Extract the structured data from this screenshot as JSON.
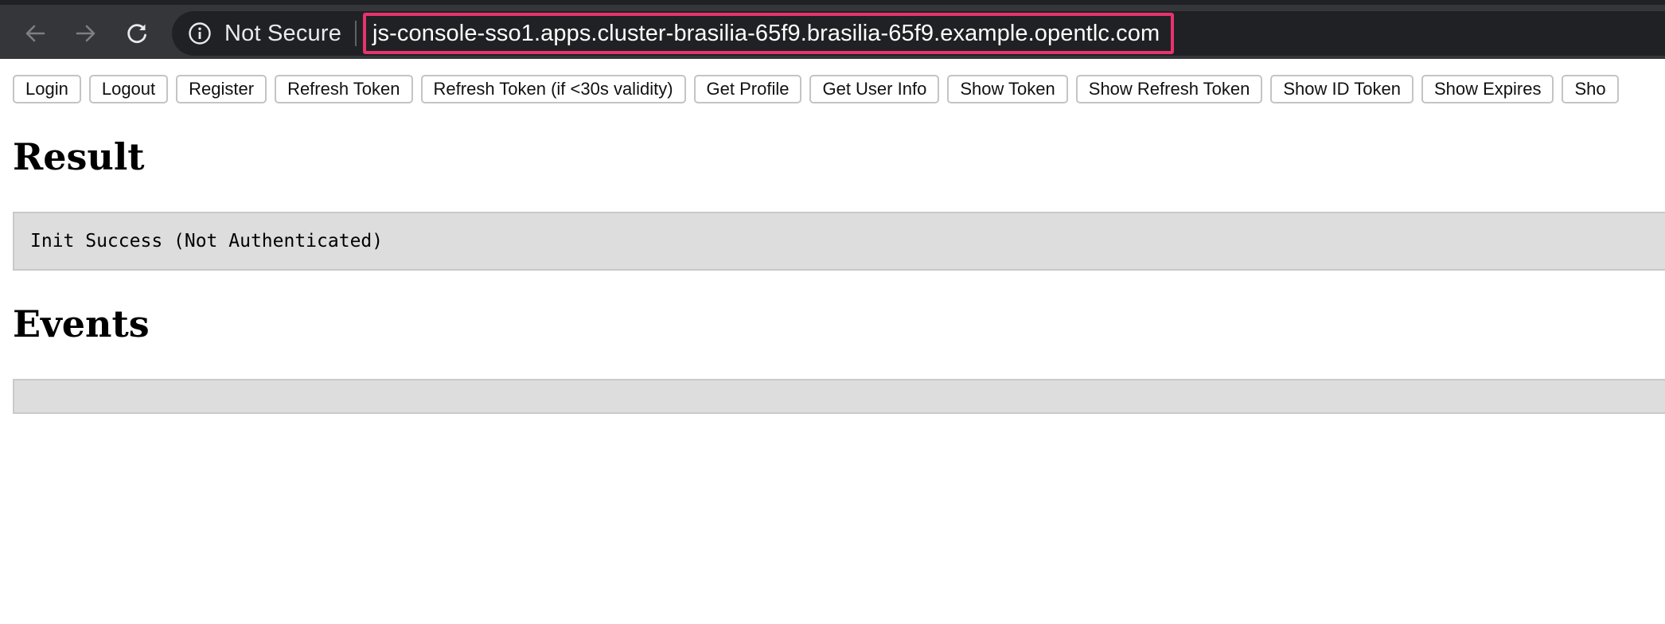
{
  "browser": {
    "security_label": "Not Secure",
    "url": "js-console-sso1.apps.cluster-brasilia-65f9.brasilia-65f9.example.opentlc.com",
    "highlight_color": "#e8336d"
  },
  "icons": {
    "back": "arrow-left-icon",
    "forward": "arrow-right-icon",
    "reload": "reload-icon",
    "security": "info-icon"
  },
  "toolbar": {
    "buttons": [
      "Login",
      "Logout",
      "Register",
      "Refresh Token",
      "Refresh Token (if <30s validity)",
      "Get Profile",
      "Get User Info",
      "Show Token",
      "Show Refresh Token",
      "Show ID Token",
      "Show Expires",
      "Sho"
    ]
  },
  "result": {
    "heading": "Result",
    "output": "Init Success (Not Authenticated)"
  },
  "events": {
    "heading": "Events",
    "output": ""
  }
}
